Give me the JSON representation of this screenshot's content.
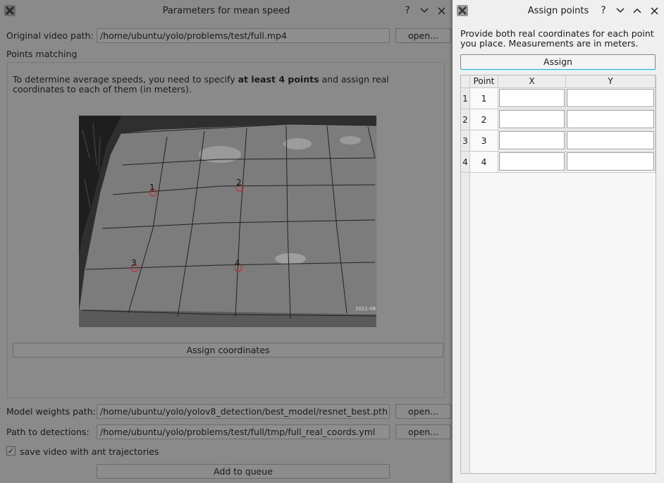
{
  "main_window": {
    "title": "Parameters for mean speed",
    "video_path_label": "Original video path:",
    "video_path_value": "/home/ubuntu/yolo/problems/test/full.mp4",
    "open_label": "open...",
    "points_matching_label": "Points matching",
    "info_before": "To determine average speeds, you need to specify ",
    "info_bold": "at least 4 points",
    "info_after": " and assign real coordinates to each of them (in meters).",
    "point_markers": [
      "1",
      "2",
      "3",
      "4"
    ],
    "preview_timestamp": "2021-06",
    "assign_coordinates_label": "Assign coordinates",
    "weights_path_label": "Model weights path:",
    "weights_path_value": "/home/ubuntu/yolo/yolov8_detection/best_model/resnet_best.pth",
    "detections_path_label": "Path to detections:",
    "detections_path_value": "/home/ubuntu/yolo/problems/test/full/tmp/full_real_coords.yml",
    "save_video_checked": true,
    "save_video_label": "save video with ant trajectories",
    "add_to_queue_label": "Add to queue"
  },
  "dialog": {
    "title": "Assign points",
    "note": "Provide both real coordinates for each point you place. Measurements are in meters.",
    "assign_label": "Assign",
    "table": {
      "headers": [
        "Point",
        "X",
        "Y"
      ],
      "rows": [
        {
          "row_num": "1",
          "point": "1",
          "x": "",
          "y": ""
        },
        {
          "row_num": "2",
          "point": "2",
          "x": "",
          "y": ""
        },
        {
          "row_num": "3",
          "point": "3",
          "x": "",
          "y": ""
        },
        {
          "row_num": "4",
          "point": "4",
          "x": "",
          "y": ""
        }
      ]
    }
  },
  "titlebar_icons": [
    "help-icon",
    "minimize-icon",
    "maximize-icon",
    "close-icon"
  ]
}
